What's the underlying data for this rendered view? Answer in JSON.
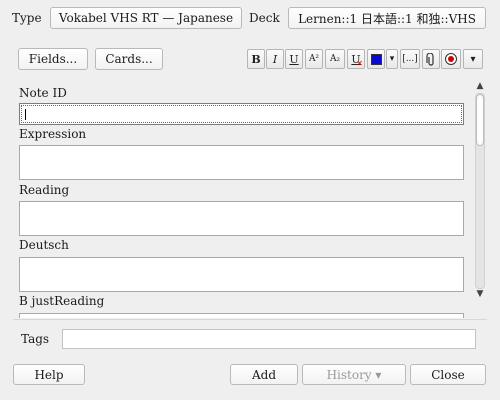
{
  "header": {
    "type_label": "Type",
    "note_type": "Vokabel VHS RT — Japanese",
    "deck_label": "Deck",
    "deck": "Lernen::1 日本語::1 和独::VHS"
  },
  "toolbar": {
    "fields_label": "Fields...",
    "cards_label": "Cards...",
    "bold": "B",
    "italic": "I",
    "underline": "U",
    "superscript": "A²",
    "subscript": "A₂",
    "clear_format": "U",
    "more": "▾",
    "cloze": "[...]",
    "text_color": "#0a0ad4",
    "icons": [
      "bold-icon",
      "italic-icon",
      "underline-icon",
      "superscript-icon",
      "subscript-icon",
      "clear-format-icon",
      "text-color-icon",
      "color-dropdown-icon",
      "cloze-icon",
      "attach-icon",
      "record-icon",
      "more-icon"
    ]
  },
  "fields": [
    {
      "name": "Note ID",
      "value": ""
    },
    {
      "name": "Expression",
      "value": ""
    },
    {
      "name": "Reading",
      "value": ""
    },
    {
      "name": "Deutsch",
      "value": ""
    },
    {
      "name": "B justReading",
      "value": ""
    }
  ],
  "tags": {
    "label": "Tags",
    "value": ""
  },
  "footer": {
    "help": "Help",
    "add": "Add",
    "history": "History ▾",
    "close": "Close"
  }
}
